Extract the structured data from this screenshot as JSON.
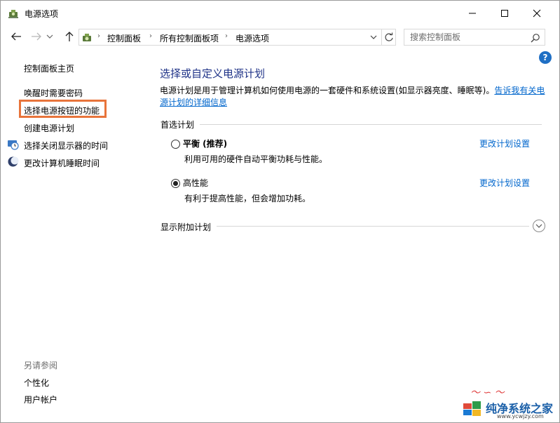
{
  "window": {
    "title": "电源选项"
  },
  "address": {
    "crumbs": [
      "控制面板",
      "所有控制面板项",
      "电源选项"
    ],
    "search_placeholder": "搜索控制面板"
  },
  "help": {
    "label": "?"
  },
  "leftnav": {
    "home": "控制面板主页",
    "items": [
      "唤醒时需要密码",
      "选择电源按钮的功能",
      "创建电源计划",
      "选择关闭显示器的时间",
      "更改计算机睡眠时间"
    ],
    "see_also_title": "另请参阅",
    "see_also": [
      "个性化",
      "用户帐户"
    ]
  },
  "main": {
    "title": "选择或自定义电源计划",
    "description": "电源计划是用于管理计算机如何使用电源的一套硬件和系统设置(如显示器亮度、睡眠等)。",
    "description_link": "告诉我有关电源计划的详细信息",
    "preferred_section": "首选计划",
    "plans": [
      {
        "name": "平衡 (推荐)",
        "desc": "利用可用的硬件自动平衡功耗与性能。",
        "link": "更改计划设置",
        "checked": false
      },
      {
        "name": "高性能",
        "desc": "有利于提高性能，但会增加功耗。",
        "link": "更改计划设置",
        "checked": true
      }
    ],
    "additional_section": "显示附加计划"
  },
  "watermark": {
    "brand": "纯净系统之家",
    "url": "www.ycwjzy.com"
  },
  "colors": {
    "title_blue": "#1e3287",
    "link_blue": "#0066cc",
    "highlight_orange": "#e8743b"
  }
}
